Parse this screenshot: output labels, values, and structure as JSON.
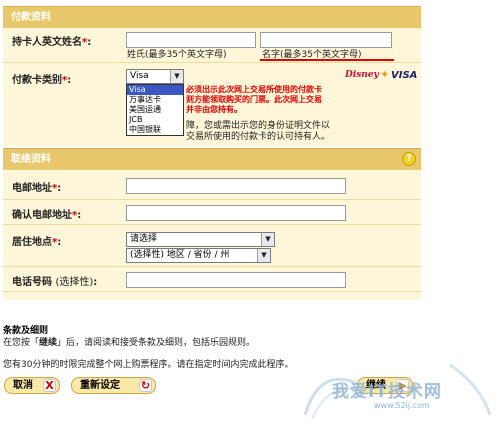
{
  "payment": {
    "title": "付款资料",
    "holder_label": "持卡人英文姓名",
    "required_mark": "*",
    "colon": ":",
    "last_name_hint": "姓氏(最多35个英文字母)",
    "first_name_hint": "名字(最多35个英文字母)",
    "card_type_label": "付款卡类别",
    "card_selected": "Visa",
    "card_options": [
      "Visa",
      "万事达卡",
      "美国运通",
      "JCB",
      "中国银联"
    ],
    "logo_disney": "Disney",
    "logo_visa": "VISA",
    "notice_fragment_1": "必须出示此次网上交易所使用的付款卡",
    "notice_fragment_2": "则方能领取购买的门票。此次网上交易",
    "notice_fragment_3": "并非由您持有。",
    "black_line_1": "障，您或需出示您的身份证明文件以",
    "black_line_2": "交易所使用的付款卡的认可持有人。"
  },
  "contact": {
    "title": "联络资料",
    "help_glyph": "?",
    "email_label": "电邮地址",
    "email_confirm_label": "确认电邮地址",
    "residence_label": "居住地点",
    "residence_value": "请选择",
    "region_value": "(选择性) 地区 / 省份 / 州",
    "phone_label": "电话号码",
    "phone_optional": "(选择性)"
  },
  "terms": {
    "title": "条款及细则",
    "line_pre": "在您按「",
    "line_bold": "继续",
    "line_post": "」后，请阅读和接受条款及细则，包括乐园规则。",
    "timer_text": "您有30分钟的时限完成整个网上购票程序。请在指定时间内完成此程序。"
  },
  "buttons": {
    "cancel": "取消",
    "reset": "重新设定",
    "continue": "继续",
    "x_glyph": "X"
  },
  "watermark": {
    "text": "我爱IT技术网",
    "url": "www.52ij.com"
  },
  "colors": {
    "section_header": "#e8c86a",
    "form_bg": "#fdf6d8",
    "notice_red": "#e00000",
    "dropdown_highlight": "#3a57c4",
    "annotation_red": "#e00000"
  }
}
